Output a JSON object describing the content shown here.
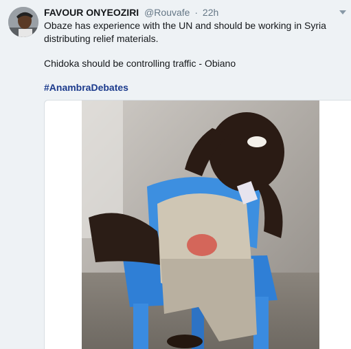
{
  "tweet": {
    "author_name": "FAVOUR ONYEOZIRI",
    "handle": "@Rouvafe",
    "separator": "·",
    "time": "22h",
    "text_line1": "Obaze has experience with the UN and should be working in Syria distributing relief materials.",
    "text_line2": "Chidoka should be controlling traffic - Obiano",
    "hashtag": "#AnambraDebates"
  },
  "colors": {
    "name": "#14171a",
    "muted": "#657786",
    "hashtag": "#1b3a8c",
    "chair": "#3d8fe0"
  },
  "icons": {
    "menu": "chevron-down-icon"
  }
}
